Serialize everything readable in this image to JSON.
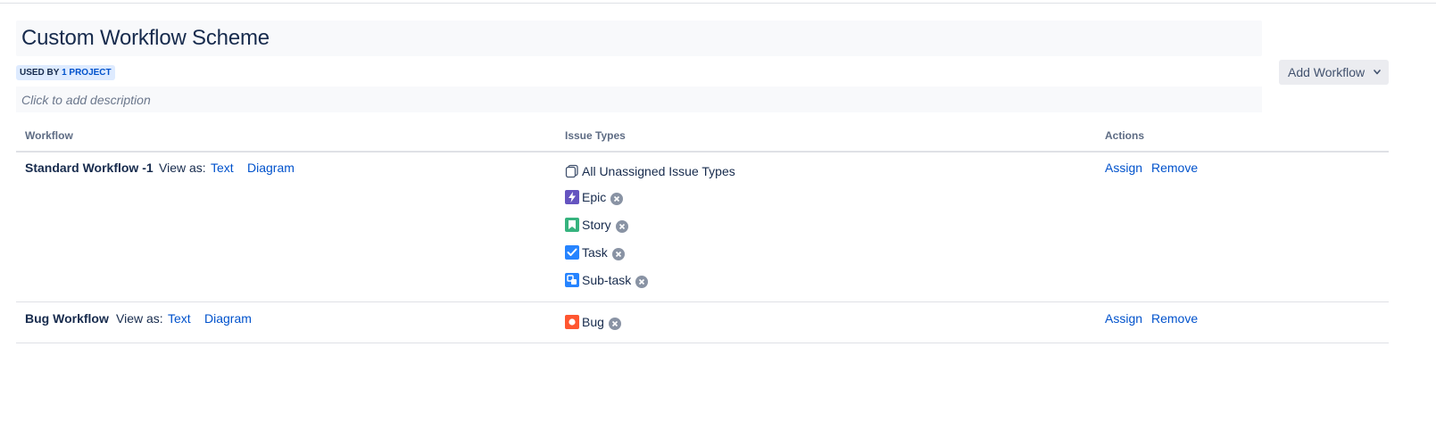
{
  "scheme": {
    "title": "Custom Workflow Scheme",
    "usage_prefix": "USED BY",
    "usage_count": "1 PROJECT",
    "description_placeholder": "Click to add description"
  },
  "toolbar": {
    "add_workflow_label": "Add Workflow"
  },
  "table": {
    "headers": [
      "Workflow",
      "Issue Types",
      "Actions"
    ],
    "view_as_label": "View as:",
    "rows": [
      {
        "workflow": "Standard Workflow -1",
        "view_text": "Text",
        "view_diagram": "Diagram",
        "issue_types": [
          "All Unassigned Issue Types",
          "Epic",
          "Story",
          "Task",
          "Sub-task"
        ],
        "actions": [
          "Assign",
          "Remove"
        ]
      },
      {
        "workflow": "Bug Workflow",
        "view_text": "Text",
        "view_diagram": "Diagram",
        "issue_types": [
          "Bug"
        ],
        "actions": [
          "Assign",
          "Remove"
        ]
      }
    ]
  },
  "icons": {
    "unassigned": "copy-icon",
    "epic": "epic-icon",
    "story": "story-icon",
    "task": "task-icon",
    "subtask": "subtask-icon",
    "bug": "bug-icon",
    "remove": "remove-circle-icon",
    "dropdown": "chevron-down-icon"
  },
  "colors": {
    "epic": "#6554c0",
    "story": "#36b37e",
    "task": "#2684ff",
    "subtask": "#2684ff",
    "bug": "#ff5630",
    "link": "#0052cc",
    "badge_bg": "#deebff"
  }
}
